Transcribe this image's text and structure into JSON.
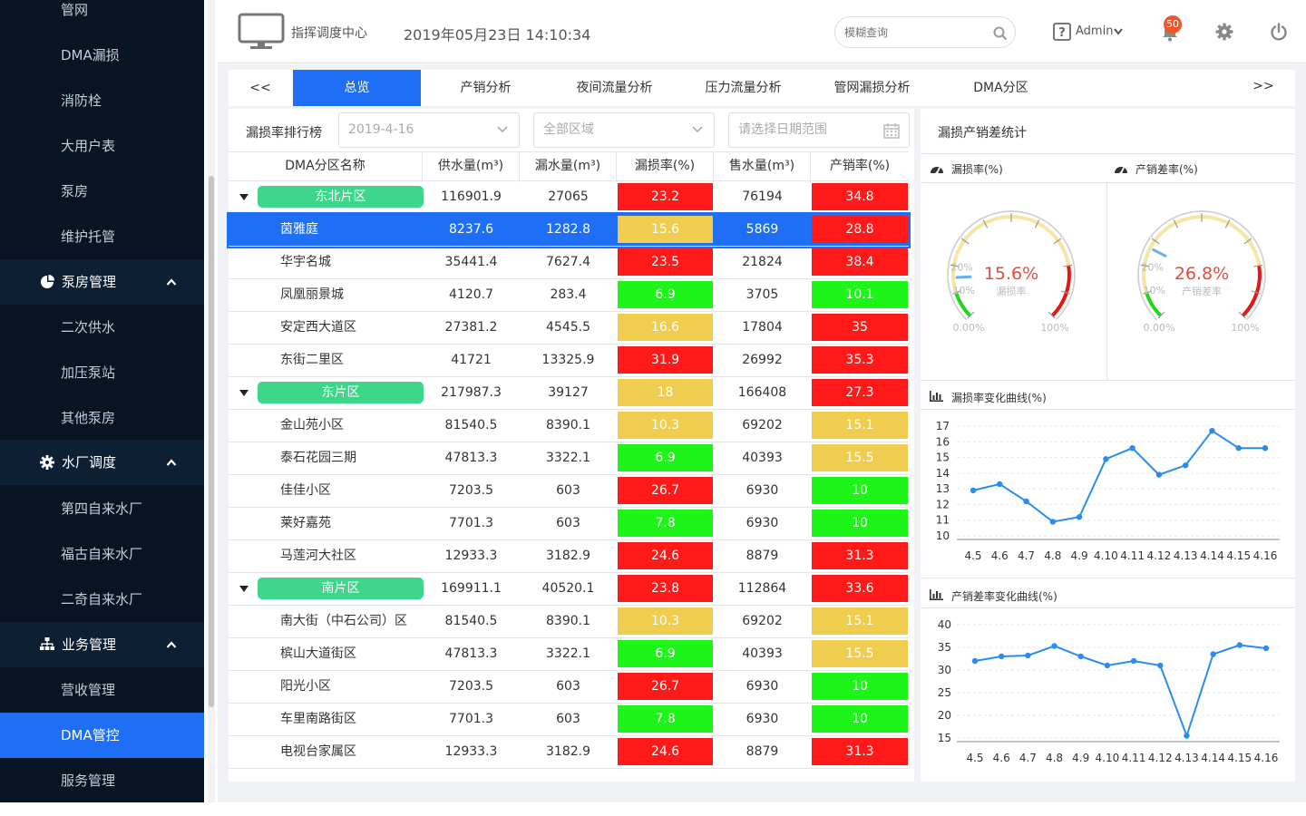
{
  "sidebar": {
    "items": [
      {
        "label": "管网",
        "type": "item"
      },
      {
        "label": "DMA漏损",
        "type": "item"
      },
      {
        "label": "消防栓",
        "type": "item"
      },
      {
        "label": "大用户表",
        "type": "item"
      },
      {
        "label": "泵房",
        "type": "item"
      },
      {
        "label": "维护托管",
        "type": "item"
      },
      {
        "label": "泵房管理",
        "type": "group",
        "icon": "pie-chart-icon"
      },
      {
        "label": "二次供水",
        "type": "item"
      },
      {
        "label": "加压泵站",
        "type": "item"
      },
      {
        "label": "其他泵房",
        "type": "item"
      },
      {
        "label": "水厂调度",
        "type": "group",
        "icon": "gear-icon"
      },
      {
        "label": "第四自来水厂",
        "type": "item"
      },
      {
        "label": "福古自来水厂",
        "type": "item"
      },
      {
        "label": "二奇自来水厂",
        "type": "item"
      },
      {
        "label": "业务管理",
        "type": "group",
        "icon": "sitemap-icon"
      },
      {
        "label": "营收管理",
        "type": "item"
      },
      {
        "label": "DMA管控",
        "type": "item",
        "active": true
      },
      {
        "label": "服务管理",
        "type": "item"
      }
    ]
  },
  "header": {
    "title": "指挥调度中心",
    "datetime": "2019年05月23日 14:10:34",
    "search_placeholder": "模糊查询",
    "user": "Admin",
    "notification_count": "50"
  },
  "tabs": {
    "prev": "<<",
    "next": ">>",
    "items": [
      "总览",
      "产销分析",
      "夜间流量分析",
      "压力流量分析",
      "管网漏损分析",
      "DMA分区"
    ],
    "active_index": 0
  },
  "leak_ranking": {
    "title": "漏损率排行榜",
    "date_value": "2019-4-16",
    "region_value": "全部区域",
    "date_range_placeholder": "请选择日期范围",
    "columns": [
      "DMA分区名称",
      "供水量(m³)",
      "漏水量(m³)",
      "漏损率(%)",
      "售水量(m³)",
      "产销率(%)"
    ],
    "rows": [
      {
        "group": true,
        "name": "东北片区",
        "supply": "116901.9",
        "leak": "27065",
        "leak_rate": "23.2",
        "leak_color": "red",
        "sold": "76194",
        "sales_rate": "34.8",
        "sales_color": "red"
      },
      {
        "name": "茵雅庭",
        "selected": true,
        "supply": "8237.6",
        "leak": "1282.8",
        "leak_rate": "15.6",
        "leak_color": "yellow",
        "sold": "5869",
        "sales_rate": "28.8",
        "sales_color": "red"
      },
      {
        "name": "华宇名城",
        "supply": "35441.4",
        "leak": "7627.4",
        "leak_rate": "23.5",
        "leak_color": "red",
        "sold": "21824",
        "sales_rate": "38.4",
        "sales_color": "red"
      },
      {
        "name": "凤凰丽景城",
        "supply": "4120.7",
        "leak": "283.4",
        "leak_rate": "6.9",
        "leak_color": "green",
        "sold": "3705",
        "sales_rate": "10.1",
        "sales_color": "green"
      },
      {
        "name": "安定西大道区",
        "supply": "27381.2",
        "leak": "4545.5",
        "leak_rate": "16.6",
        "leak_color": "yellow",
        "sold": "17804",
        "sales_rate": "35",
        "sales_color": "red"
      },
      {
        "name": "东街二里区",
        "supply": "41721",
        "leak": "13325.9",
        "leak_rate": "31.9",
        "leak_color": "red",
        "sold": "26992",
        "sales_rate": "35.3",
        "sales_color": "red"
      },
      {
        "group": true,
        "name": "东片区",
        "supply": "217987.3",
        "leak": "39127",
        "leak_rate": "18",
        "leak_color": "yellow",
        "sold": "166408",
        "sales_rate": "27.3",
        "sales_color": "red"
      },
      {
        "name": "金山苑小区",
        "supply": "81540.5",
        "leak": "8390.1",
        "leak_rate": "10.3",
        "leak_color": "yellow",
        "sold": "69202",
        "sales_rate": "15.1",
        "sales_color": "yellow"
      },
      {
        "name": "泰石花园三期",
        "supply": "47813.3",
        "leak": "3322.1",
        "leak_rate": "6.9",
        "leak_color": "green",
        "sold": "40393",
        "sales_rate": "15.5",
        "sales_color": "yellow"
      },
      {
        "name": "佳佳小区",
        "supply": "7203.5",
        "leak": "603",
        "leak_rate": "26.7",
        "leak_color": "red",
        "sold": "6930",
        "sales_rate": "10",
        "sales_color": "green"
      },
      {
        "name": "莱好嘉苑",
        "supply": "7701.3",
        "leak": "603",
        "leak_rate": "7.8",
        "leak_color": "green",
        "sold": "6930",
        "sales_rate": "10",
        "sales_color": "green"
      },
      {
        "name": "马莲河大社区",
        "supply": "12933.3",
        "leak": "3182.9",
        "leak_rate": "24.6",
        "leak_color": "red",
        "sold": "8879",
        "sales_rate": "31.3",
        "sales_color": "red"
      },
      {
        "group": true,
        "name": "南片区",
        "supply": "169911.1",
        "leak": "40520.1",
        "leak_rate": "23.8",
        "leak_color": "red",
        "sold": "112864",
        "sales_rate": "33.6",
        "sales_color": "red"
      },
      {
        "name": "南大街（中石公司）区",
        "supply": "81540.5",
        "leak": "8390.1",
        "leak_rate": "10.3",
        "leak_color": "yellow",
        "sold": "69202",
        "sales_rate": "15.1",
        "sales_color": "yellow"
      },
      {
        "name": "槟山大道街区",
        "supply": "47813.3",
        "leak": "3322.1",
        "leak_rate": "6.9",
        "leak_color": "green",
        "sold": "40393",
        "sales_rate": "15.5",
        "sales_color": "yellow"
      },
      {
        "name": "阳光小区",
        "supply": "7203.5",
        "leak": "603",
        "leak_rate": "26.7",
        "leak_color": "red",
        "sold": "6930",
        "sales_rate": "10",
        "sales_color": "green"
      },
      {
        "name": "车里南路街区",
        "supply": "7701.3",
        "leak": "603",
        "leak_rate": "7.8",
        "leak_color": "green",
        "sold": "6930",
        "sales_rate": "10",
        "sales_color": "green"
      },
      {
        "name": "电视台家属区",
        "supply": "12933.3",
        "leak": "3182.9",
        "leak_rate": "24.6",
        "leak_color": "red",
        "sold": "8879",
        "sales_rate": "31.3",
        "sales_color": "red"
      }
    ]
  },
  "stats": {
    "title": "漏损产销差统计",
    "gauge_leak": {
      "header": "漏损率(%)",
      "value": 15.6,
      "display": "15.6%",
      "caption": "漏损率",
      "min_label": "0.00%",
      "max_label": "100%",
      "tick_10": "10%",
      "tick_20": "20%"
    },
    "gauge_sales": {
      "header": "产销差率(%)",
      "value": 26.8,
      "display": "26.8%",
      "caption": "产销差率",
      "min_label": "0.00%",
      "max_label": "100%",
      "tick_10": "10%",
      "tick_20": "20%"
    },
    "leak_curve_title": "漏损率变化曲线(%)",
    "sales_curve_title": "产销差率变化曲线(%)"
  },
  "colors": {
    "accent": "#1e6ff5",
    "red": "#ff1919",
    "yellow": "#f0cd4e",
    "green": "#1cf517",
    "pill": "#3ed68b",
    "line": "#2a8cf0"
  },
  "chart_data": [
    {
      "type": "line",
      "title": "漏损率变化曲线(%)",
      "x": [
        "4.5",
        "4.6",
        "4.7",
        "4.8",
        "4.9",
        "4.10",
        "4.11",
        "4.12",
        "4.13",
        "4.14",
        "4.15",
        "4.16"
      ],
      "series": [
        {
          "values": [
            12.9,
            13.3,
            12.2,
            10.9,
            11.2,
            14.9,
            15.6,
            13.9,
            14.5,
            16.7,
            15.6,
            15.6
          ]
        }
      ],
      "yticks": [
        10,
        11,
        12,
        13,
        14,
        15,
        16,
        17
      ],
      "ylim": [
        10,
        17
      ],
      "grid": true
    },
    {
      "type": "line",
      "title": "产销差率变化曲线(%)",
      "x": [
        "4.5",
        "4.6",
        "4.7",
        "4.8",
        "4.9",
        "4.10",
        "4.11",
        "4.12",
        "4.13",
        "4.14",
        "4.15",
        "4.16"
      ],
      "series": [
        {
          "values": [
            32,
            33,
            33.2,
            35.3,
            33,
            31,
            32,
            31,
            15.5,
            33.5,
            35.5,
            34.8
          ]
        }
      ],
      "yticks": [
        15,
        20,
        25,
        30,
        35,
        40
      ],
      "ylim": [
        15,
        40
      ],
      "grid": true
    }
  ]
}
